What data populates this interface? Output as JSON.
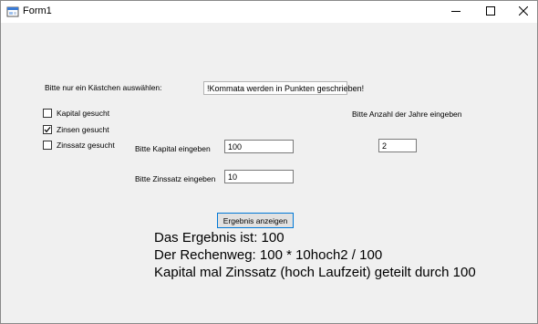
{
  "window": {
    "title": "Form1"
  },
  "labels": {
    "select_one": "Bitte nur ein Kästchen auswählen:",
    "years_prompt": "Bitte Anzahl der Jahre eingeben",
    "capital_prompt": "Bitte Kapital eingeben",
    "rate_prompt": "Bitte Zinssatz eingeben"
  },
  "hint_box": {
    "value": "!Kommata werden in Punkten geschrieben!"
  },
  "checkboxes": [
    {
      "label": "Kapital gesucht",
      "checked": false
    },
    {
      "label": "Zinsen gesucht",
      "checked": true
    },
    {
      "label": "Zinssatz gesucht",
      "checked": false
    }
  ],
  "inputs": {
    "years": "2",
    "capital": "100",
    "rate": "10"
  },
  "button": {
    "label": "Ergebnis anzeigen"
  },
  "results": {
    "line1": "Das Ergebnis ist: 100",
    "line2": "Der Rechenweg: 100 * 10hoch2 / 100",
    "line3": "Kapital mal Zinssatz (hoch Laufzeit) geteilt durch 100"
  },
  "colors": {
    "form_background": "#f0f0f0",
    "button_border": "#0078d7",
    "titlebar": "#ffffff"
  }
}
